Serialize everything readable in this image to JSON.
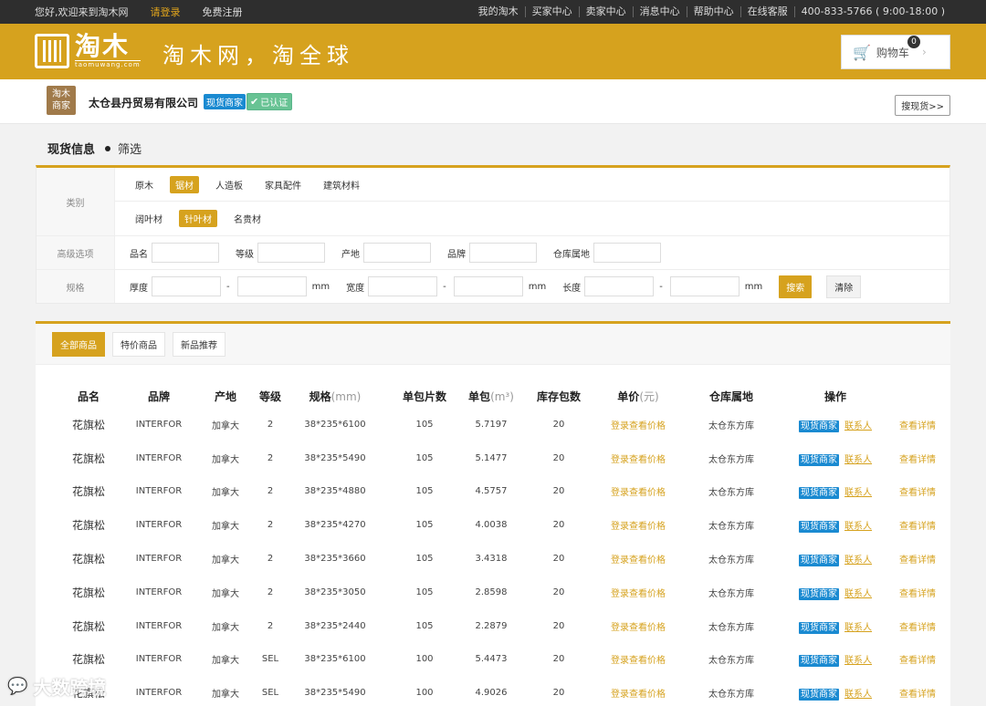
{
  "topbar": {
    "welcome": "您好,欢迎来到淘木网",
    "login": "请登录",
    "register": "免费注册",
    "links": [
      "我的淘木",
      "买家中心",
      "卖家中心",
      "消息中心",
      "帮助中心",
      "在线客服",
      "400-833-5766 ( 9:00-18:00 )"
    ]
  },
  "header": {
    "logo_text": "淘木",
    "logo_sub": "taomuwang.com",
    "slogan": "淘木网，淘全球",
    "cart_label": "购物车",
    "cart_count": "0"
  },
  "company": {
    "badge_line1": "淘木",
    "badge_line2": "商家",
    "name": "太仓县丹贸易有限公司",
    "tag_spot": "现货商家",
    "tag_verified": "已认证",
    "search_spot": "搜现货>>"
  },
  "section": {
    "title": "现货信息",
    "sub": "筛选"
  },
  "filter": {
    "category_label": "类别",
    "categories_row1": [
      "原木",
      "锯材",
      "人造板",
      "家具配件",
      "建筑材料"
    ],
    "categories_row2": [
      "阔叶材",
      "针叶材",
      "名贵材"
    ],
    "advanced_label": "高级选项",
    "advanced_fields": [
      "品名",
      "等级",
      "产地",
      "品牌",
      "仓库属地"
    ],
    "spec_label": "规格",
    "spec_fields": [
      "厚度",
      "宽度",
      "长度"
    ],
    "unit": "mm",
    "dash": "-",
    "search_btn": "搜索",
    "clear_btn": "清除"
  },
  "tabs": [
    "全部商品",
    "特价商品",
    "新品推荐"
  ],
  "table": {
    "headers": {
      "name": "品名",
      "brand": "品牌",
      "origin": "产地",
      "grade": "等级",
      "spec": "规格",
      "spec_unit": "(mm)",
      "pieces": "单包片数",
      "volume": "单包",
      "volume_unit": "(m³)",
      "stock": "库存包数",
      "price": "单价",
      "price_unit": "(元)",
      "warehouse": "仓库属地",
      "ops": "操作"
    },
    "rows": [
      {
        "name": "花旗松",
        "brand": "INTERFOR",
        "origin": "加拿大",
        "grade": "2",
        "spec": "38*235*6100",
        "pieces": "105",
        "volume": "5.7197",
        "stock": "20",
        "price": "登录查看价格",
        "warehouse": "太仓东方库",
        "tag": "现货商家",
        "contact": "联系人",
        "detail": "查看详情"
      },
      {
        "name": "花旗松",
        "brand": "INTERFOR",
        "origin": "加拿大",
        "grade": "2",
        "spec": "38*235*5490",
        "pieces": "105",
        "volume": "5.1477",
        "stock": "20",
        "price": "登录查看价格",
        "warehouse": "太仓东方库",
        "tag": "现货商家",
        "contact": "联系人",
        "detail": "查看详情"
      },
      {
        "name": "花旗松",
        "brand": "INTERFOR",
        "origin": "加拿大",
        "grade": "2",
        "spec": "38*235*4880",
        "pieces": "105",
        "volume": "4.5757",
        "stock": "20",
        "price": "登录查看价格",
        "warehouse": "太仓东方库",
        "tag": "现货商家",
        "contact": "联系人",
        "detail": "查看详情"
      },
      {
        "name": "花旗松",
        "brand": "INTERFOR",
        "origin": "加拿大",
        "grade": "2",
        "spec": "38*235*4270",
        "pieces": "105",
        "volume": "4.0038",
        "stock": "20",
        "price": "登录查看价格",
        "warehouse": "太仓东方库",
        "tag": "现货商家",
        "contact": "联系人",
        "detail": "查看详情"
      },
      {
        "name": "花旗松",
        "brand": "INTERFOR",
        "origin": "加拿大",
        "grade": "2",
        "spec": "38*235*3660",
        "pieces": "105",
        "volume": "3.4318",
        "stock": "20",
        "price": "登录查看价格",
        "warehouse": "太仓东方库",
        "tag": "现货商家",
        "contact": "联系人",
        "detail": "查看详情"
      },
      {
        "name": "花旗松",
        "brand": "INTERFOR",
        "origin": "加拿大",
        "grade": "2",
        "spec": "38*235*3050",
        "pieces": "105",
        "volume": "2.8598",
        "stock": "20",
        "price": "登录查看价格",
        "warehouse": "太仓东方库",
        "tag": "现货商家",
        "contact": "联系人",
        "detail": "查看详情"
      },
      {
        "name": "花旗松",
        "brand": "INTERFOR",
        "origin": "加拿大",
        "grade": "2",
        "spec": "38*235*2440",
        "pieces": "105",
        "volume": "2.2879",
        "stock": "20",
        "price": "登录查看价格",
        "warehouse": "太仓东方库",
        "tag": "现货商家",
        "contact": "联系人",
        "detail": "查看详情"
      },
      {
        "name": "花旗松",
        "brand": "INTERFOR",
        "origin": "加拿大",
        "grade": "SEL",
        "spec": "38*235*6100",
        "pieces": "100",
        "volume": "5.4473",
        "stock": "20",
        "price": "登录查看价格",
        "warehouse": "太仓东方库",
        "tag": "现货商家",
        "contact": "联系人",
        "detail": "查看详情"
      },
      {
        "name": "花旗松",
        "brand": "INTERFOR",
        "origin": "加拿大",
        "grade": "SEL",
        "spec": "38*235*5490",
        "pieces": "100",
        "volume": "4.9026",
        "stock": "20",
        "price": "登录查看价格",
        "warehouse": "太仓东方库",
        "tag": "现货商家",
        "contact": "联系人",
        "detail": "查看详情"
      }
    ]
  },
  "watermark": "大数跨境",
  "colors": {
    "accent": "#d6a21e",
    "topbar": "#2e2e2e",
    "tag_blue": "#1a8ad1",
    "verified": "#68c394"
  }
}
